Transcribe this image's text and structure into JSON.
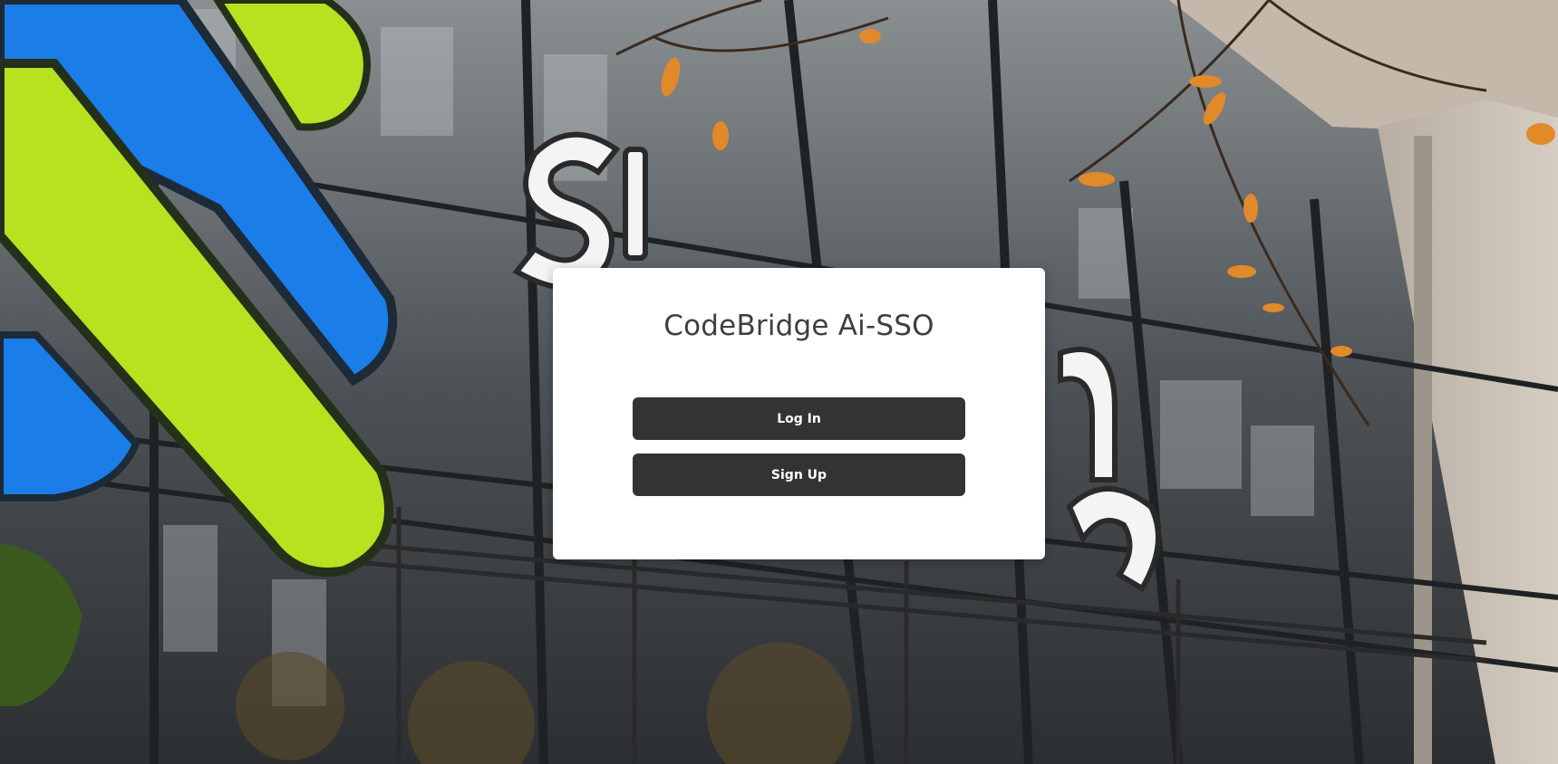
{
  "app": {
    "title": "CodeBridge Ai-SSO"
  },
  "actions": {
    "login_label": "Log In",
    "signup_label": "Sign Up"
  },
  "colors": {
    "brand_blue": "#1a7de8",
    "brand_green": "#b6e21f",
    "button_bg": "#333333",
    "card_bg": "#ffffff",
    "title_text": "#3f3f3f"
  },
  "background": {
    "image_subject": "building-facade-with-bank-signage"
  }
}
